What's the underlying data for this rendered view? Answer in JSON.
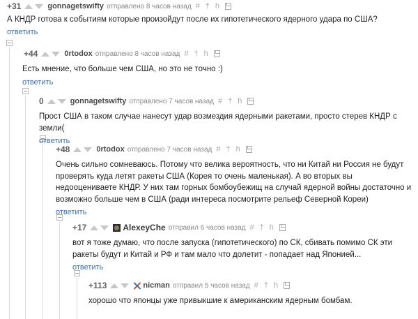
{
  "comments": [
    {
      "rating": "+31",
      "author": "gonnagetswifty",
      "meta": "отправлено 8 часов назад",
      "text": "А КНДР готова к событиям которые произойдут после их гипотетического ядерного удара по США?",
      "reply": "ответить"
    },
    {
      "rating": "+44",
      "author": "0rtodox",
      "meta": "отправлено 8 часов назад",
      "text": "Есть мнение, что больше чем США, но это не точно :)",
      "reply": "ответить"
    },
    {
      "rating": "0",
      "author": "gonnagetswifty",
      "meta": "отправлено 7 часов назад",
      "text": "Прост США в таком случае нанесут удар возмездия ядерными ракетами, просто стерев КНДР с земли(",
      "reply": "ответить"
    },
    {
      "rating": "+48",
      "author": "0rtodox",
      "meta": "отправлено 7 часов назад",
      "text": "Очень сильно сомневаюсь. Потому что велика вероятность, что ни Китай ни Россия не будут проверять куда летят ракеты США (Корея то очень маленькая). А во вторых вы недооцениваете КНДР. У них там горных бомбоубежищ на случай ядерной войны достаточно и возможно больше чем в США (ради интереса посмотрите рельеф Северной Кореи)",
      "reply": "ответить"
    },
    {
      "rating": "+17",
      "author": "AlexeyChe",
      "meta": "отправил 6 часов назад",
      "text": "вот я тоже думаю, что после запуска (гипотетического) по СК, сбивать помимо СК эти ракеты будут и Китай и РФ и там мало что долетит - попадает над Японией...",
      "reply": "ответить"
    },
    {
      "rating": "+113",
      "author": "nicman",
      "meta": "отправил 5 часов назад",
      "text": "хорошо что японцы уже привыкшие к американским ядерным бомбам.",
      "reply": ""
    }
  ],
  "icons": {
    "link": "#",
    "pin": "pin-icon",
    "user": "user-icon",
    "save": "save-icon"
  },
  "colors": {
    "reply_link": "#3a6fa8",
    "vote_arrows": "#c7c7c7",
    "thread_line": "#d9d9d9"
  }
}
